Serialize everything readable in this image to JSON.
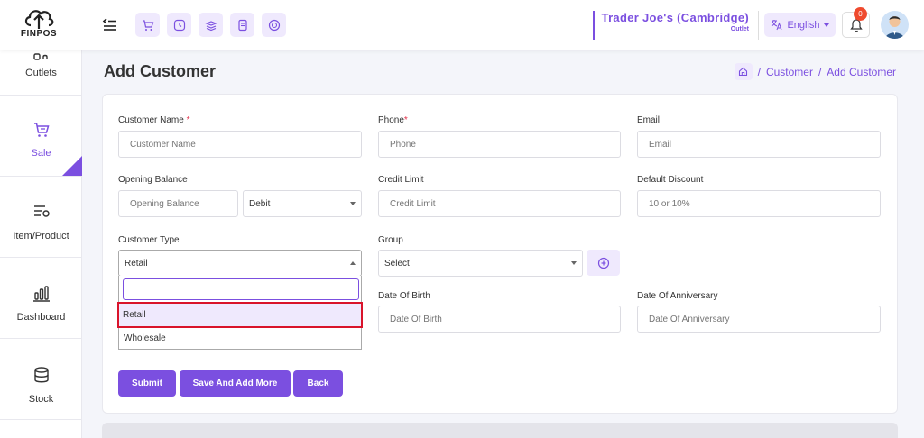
{
  "header": {
    "logo_text": "FINPOS",
    "store_name": "Trader Joe's (Cambridge)",
    "store_type": "Outlet",
    "language": "English",
    "notification_count": "0",
    "accent": "#7b4fe0"
  },
  "sidebar": {
    "items": [
      {
        "label": "Outlets",
        "icon": "outlet-icon"
      },
      {
        "label": "Sale",
        "icon": "cart-icon"
      },
      {
        "label": "Item/Product",
        "icon": "list-icon"
      },
      {
        "label": "Dashboard",
        "icon": "chart-icon"
      },
      {
        "label": "Stock",
        "icon": "database-icon"
      }
    ]
  },
  "page": {
    "title": "Add Customer",
    "breadcrumb": [
      "Customer",
      "Add Customer"
    ]
  },
  "form": {
    "customer_name": {
      "label": "Customer Name",
      "placeholder": "Customer Name"
    },
    "phone": {
      "label": "Phone",
      "placeholder": "Phone"
    },
    "email": {
      "label": "Email",
      "placeholder": "Email"
    },
    "opening_balance": {
      "label": "Opening Balance",
      "placeholder": "Opening Balance",
      "type_value": "Debit"
    },
    "credit_limit": {
      "label": "Credit Limit",
      "placeholder": "Credit Limit"
    },
    "default_discount": {
      "label": "Default Discount",
      "placeholder": "10 or 10%"
    },
    "customer_type": {
      "label": "Customer Type",
      "value": "Retail",
      "options": [
        "Retail",
        "Wholesale"
      ]
    },
    "group": {
      "label": "Group",
      "value": "Select"
    },
    "date_of_birth": {
      "label": "Date Of Birth",
      "placeholder": "Date Of Birth"
    },
    "date_of_anniversary": {
      "label": "Date Of Anniversary",
      "placeholder": "Date Of Anniversary"
    },
    "required_mark": "*"
  },
  "buttons": {
    "submit": "Submit",
    "save_add_more": "Save And Add More",
    "back": "Back"
  }
}
